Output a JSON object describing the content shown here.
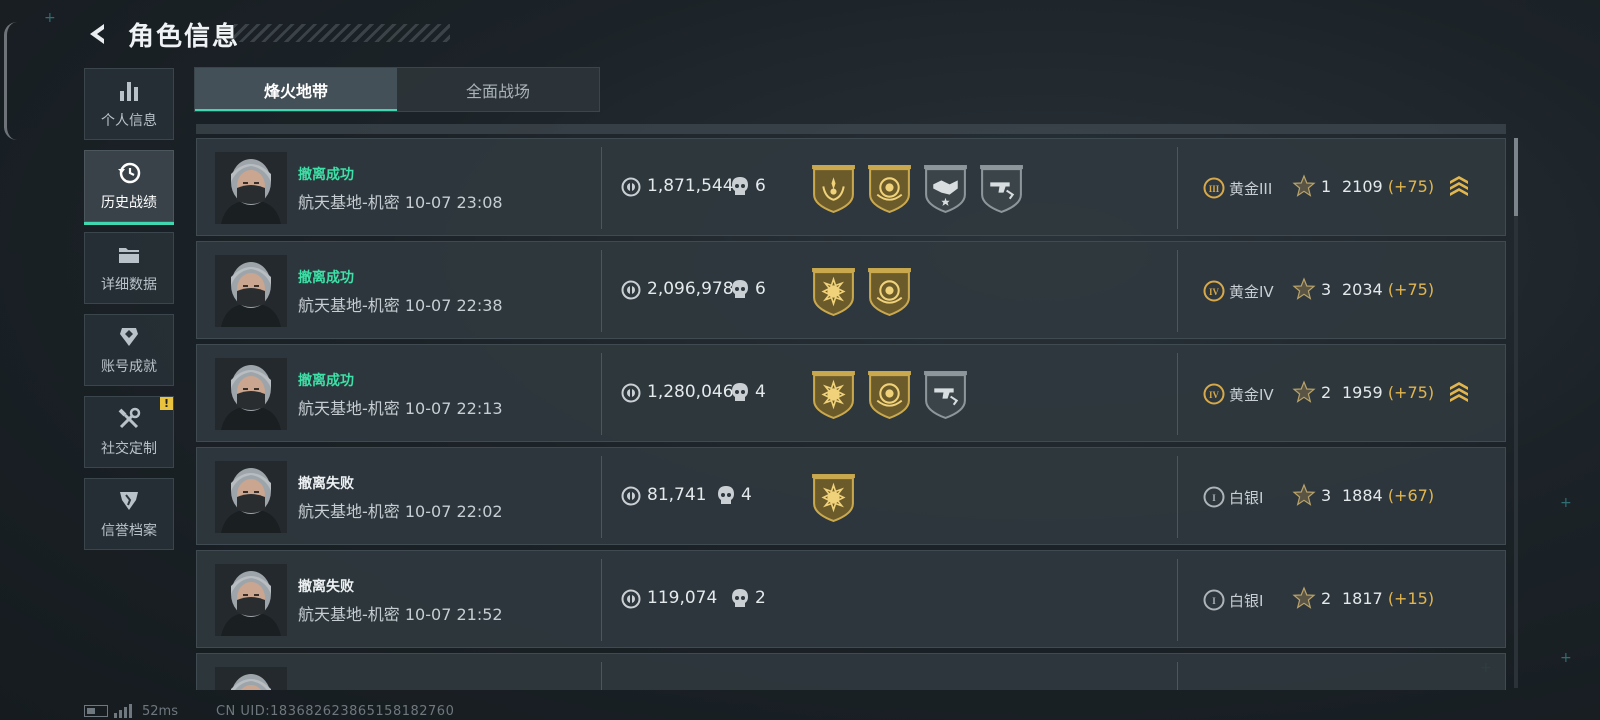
{
  "header": {
    "title": "角色信息",
    "back_icon": "back-arrow-icon"
  },
  "sidebar": {
    "items": [
      {
        "label": "个人信息",
        "icon": "bar-chart-icon",
        "active": false
      },
      {
        "label": "历史战绩",
        "icon": "history-clock-icon",
        "active": true
      },
      {
        "label": "详细数据",
        "icon": "folder-icon",
        "active": false
      },
      {
        "label": "账号成就",
        "icon": "achievement-icon",
        "active": false
      },
      {
        "label": "社交定制",
        "icon": "tools-icon",
        "active": false,
        "badge": "!"
      },
      {
        "label": "信誉档案",
        "icon": "credit-icon",
        "active": false
      }
    ]
  },
  "tabs": [
    {
      "label": "烽火地带",
      "active": true
    },
    {
      "label": "全面战场",
      "active": false
    }
  ],
  "matches": [
    {
      "status": "撤离成功",
      "success": true,
      "map": "航天基地-机密",
      "time": "10-07 23:08",
      "value": "1,871,544",
      "kills": "6",
      "medals": [
        "gold-wreath-medal-icon",
        "gold-coin-medal-icon",
        "gray-handshake-medal-icon",
        "gray-gun-medal-icon"
      ],
      "rank": "黄金III",
      "rank_numeral": "III",
      "stars": "1",
      "score": "2109",
      "delta": "(+75)",
      "promo": true
    },
    {
      "status": "撤离成功",
      "success": true,
      "map": "航天基地-机密",
      "time": "10-07 22:38",
      "value": "2,096,978",
      "kills": "6",
      "medals": [
        "gold-sun-medal-icon",
        "gold-coin-medal-icon"
      ],
      "rank": "黄金IV",
      "rank_numeral": "IV",
      "stars": "3",
      "score": "2034",
      "delta": "(+75)",
      "promo": false
    },
    {
      "status": "撤离成功",
      "success": true,
      "map": "航天基地-机密",
      "time": "10-07 22:13",
      "value": "1,280,046",
      "kills": "4",
      "medals": [
        "gold-sun-medal-icon",
        "gold-coin-medal-icon",
        "gray-gun-medal-icon"
      ],
      "rank": "黄金IV",
      "rank_numeral": "IV",
      "stars": "2",
      "score": "1959",
      "delta": "(+75)",
      "promo": true
    },
    {
      "status": "撤离失败",
      "success": false,
      "map": "航天基地-机密",
      "time": "10-07 22:02",
      "value": "81,741",
      "kills": "4",
      "medals": [
        "gold-sun-medal-icon"
      ],
      "rank": "白银I",
      "rank_numeral": "I",
      "stars": "3",
      "score": "1884",
      "delta": "(+67)",
      "promo": false
    },
    {
      "status": "撤离失败",
      "success": false,
      "map": "航天基地-机密",
      "time": "10-07 21:52",
      "value": "119,074",
      "kills": "2",
      "medals": [],
      "rank": "白银I",
      "rank_numeral": "I",
      "stars": "2",
      "score": "1817",
      "delta": "(+15)",
      "promo": false
    }
  ],
  "footer": {
    "ping": "52ms",
    "uid": "CN UID:1836826238651581827​60"
  },
  "colors": {
    "accent": "#3fd8b0",
    "success": "#3de0a7",
    "gold": "#e2b64f",
    "silver": "#c9cfd3"
  }
}
